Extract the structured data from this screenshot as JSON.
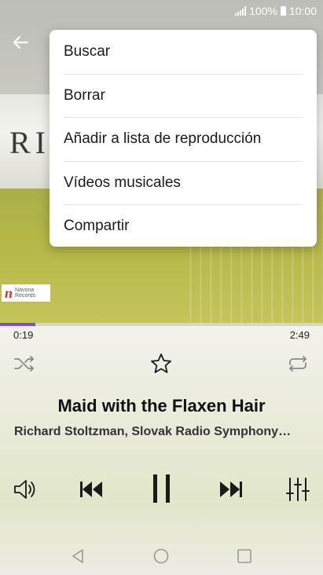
{
  "status_bar": {
    "battery": "100%",
    "time": "10:00"
  },
  "album_art": {
    "text": "RI",
    "label_logo_letter": "n",
    "label_logo_line1": "Navona",
    "label_logo_line2": "Records"
  },
  "menu": {
    "items": [
      {
        "label": "Buscar"
      },
      {
        "label": "Borrar"
      },
      {
        "label": "Añadir a lista de reproducción"
      },
      {
        "label": "Vídeos musicales"
      },
      {
        "label": "Compartir"
      }
    ]
  },
  "player": {
    "elapsed": "0:19",
    "duration": "2:49",
    "progress": 0.11,
    "title": "Maid with the Flaxen Hair",
    "artist": "Richard Stoltzman, Slovak Radio Symphony…"
  },
  "colors": {
    "accent": "#7b4fd6",
    "icon": "#1a1a1a",
    "inactive_icon": "#8a8a80"
  },
  "icons": [
    "signal-icon",
    "battery-icon",
    "back-arrow-icon",
    "shuffle-icon",
    "star-icon",
    "repeat-icon",
    "volume-icon",
    "previous-icon",
    "pause-icon",
    "next-icon",
    "equalizer-icon",
    "nav-back-icon",
    "nav-home-icon",
    "nav-recents-icon"
  ]
}
